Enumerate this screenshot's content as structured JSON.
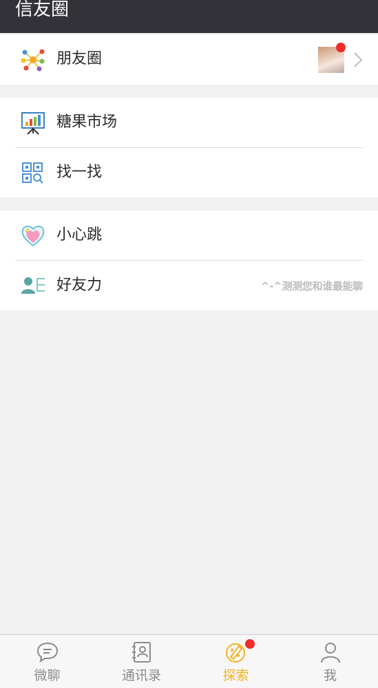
{
  "header": {
    "title": "信友圈"
  },
  "moments": {
    "label": "朋友圈",
    "icon": "network-nodes-icon",
    "has_new": true
  },
  "group2": [
    {
      "label": "糖果市场",
      "icon": "presentation-chart-icon"
    },
    {
      "label": "找一找",
      "icon": "qr-scan-icon"
    }
  ],
  "group3": [
    {
      "label": "小心跳",
      "icon": "heart-icon"
    },
    {
      "label": "好友力",
      "icon": "friend-list-icon",
      "hint": "^-^测测您和谁最能聊"
    }
  ],
  "tabs": [
    {
      "label": "微聊",
      "icon": "chat-bubble-icon",
      "active": false
    },
    {
      "label": "通讯录",
      "icon": "contacts-book-icon",
      "active": false
    },
    {
      "label": "探索",
      "icon": "discover-icon",
      "active": true,
      "badge": true
    },
    {
      "label": "我",
      "icon": "person-icon",
      "active": false
    }
  ],
  "colors": {
    "header_bg": "#333238",
    "active_tab": "#f4b323",
    "badge_red": "#f22b2b",
    "page_bg": "#f1f1f1"
  }
}
